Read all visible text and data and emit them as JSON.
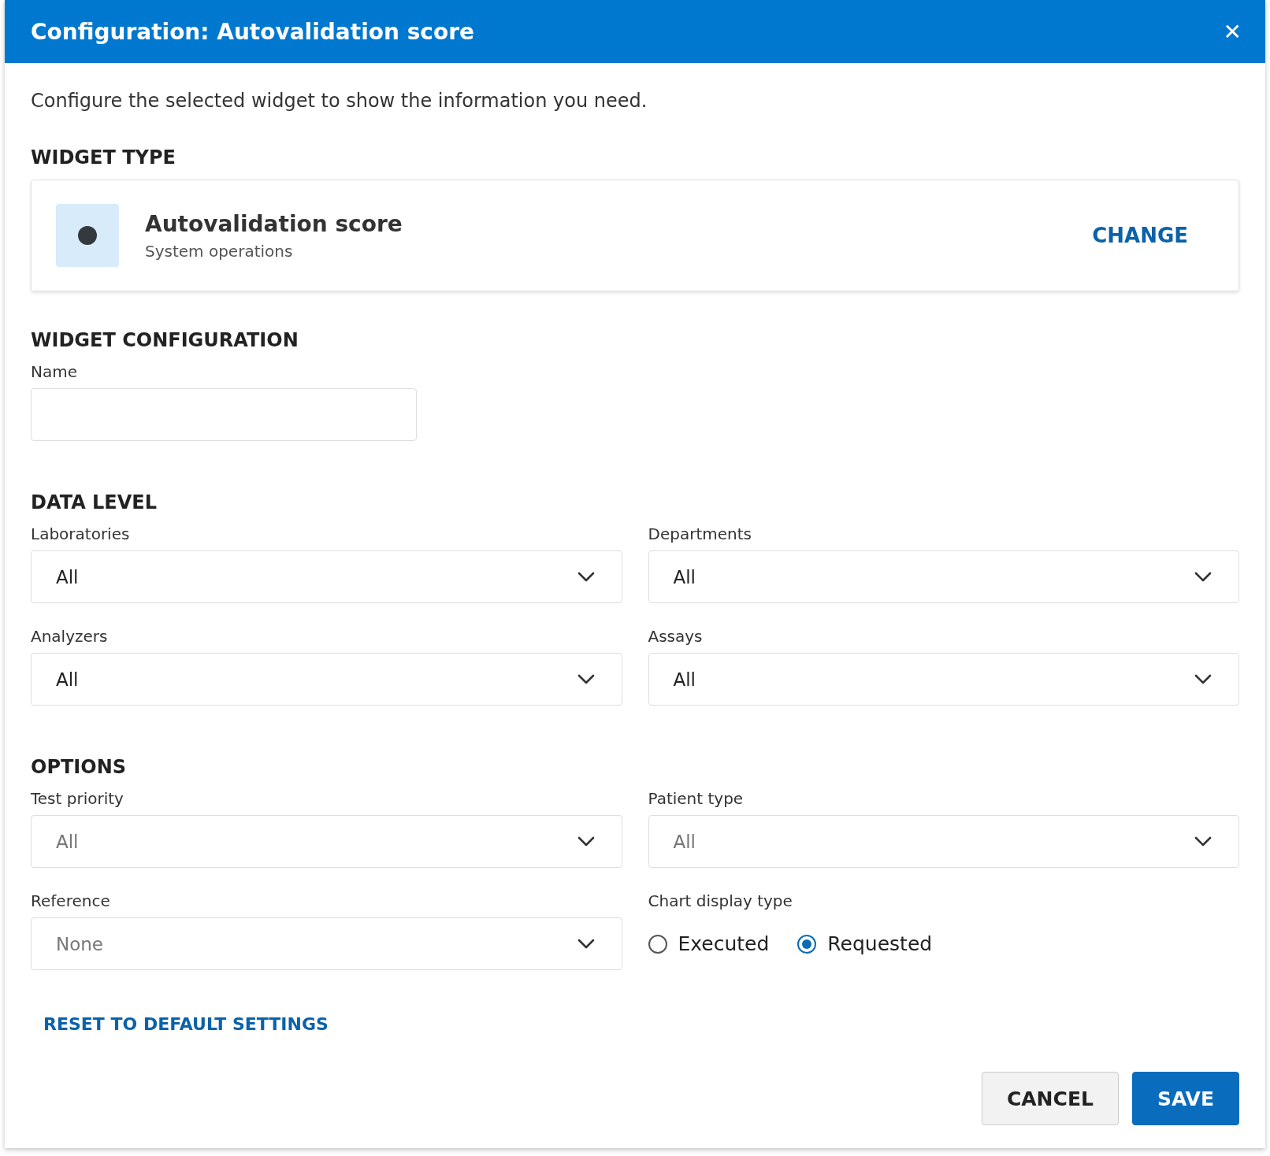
{
  "dialog": {
    "title": "Configuration: Autovalidation score",
    "close": "✕",
    "description": "Configure the selected widget to show the information you need."
  },
  "widget_type": {
    "heading": "WIDGET TYPE",
    "name": "Autovalidation score",
    "category": "System operations",
    "action": "CHANGE"
  },
  "widget_configuration": {
    "heading": "WIDGET CONFIGURATION",
    "name_label": "Name"
  },
  "data_level": {
    "heading": "DATA LEVEL",
    "fields": [
      {
        "kind": "select",
        "label": "Laboratories",
        "value": "All",
        "disabled": false
      },
      {
        "kind": "select",
        "label": "Departments",
        "value": "All",
        "disabled": false
      },
      {
        "kind": "select",
        "label": "Analyzers",
        "value": "All",
        "disabled": false
      },
      {
        "kind": "select",
        "label": "Assays",
        "value": "All",
        "disabled": false
      }
    ]
  },
  "options": {
    "heading": "OPTIONS",
    "fields": [
      {
        "kind": "select",
        "label": "Test priority",
        "value": "All",
        "disabled": true
      },
      {
        "kind": "select",
        "label": "Patient type",
        "value": "All",
        "disabled": true
      },
      {
        "kind": "select",
        "label": "Reference",
        "value": "None",
        "disabled": true
      },
      {
        "kind": "radio",
        "label": "Chart display type",
        "choices": [
          {
            "label": "Executed",
            "selected": false
          },
          {
            "label": "Requested",
            "selected": true
          }
        ]
      }
    ]
  },
  "reset": "RESET TO DEFAULT SETTINGS",
  "buttons": [
    {
      "kind": "secondary",
      "label": "CANCEL"
    },
    {
      "kind": "primary",
      "label": "SAVE"
    }
  ]
}
